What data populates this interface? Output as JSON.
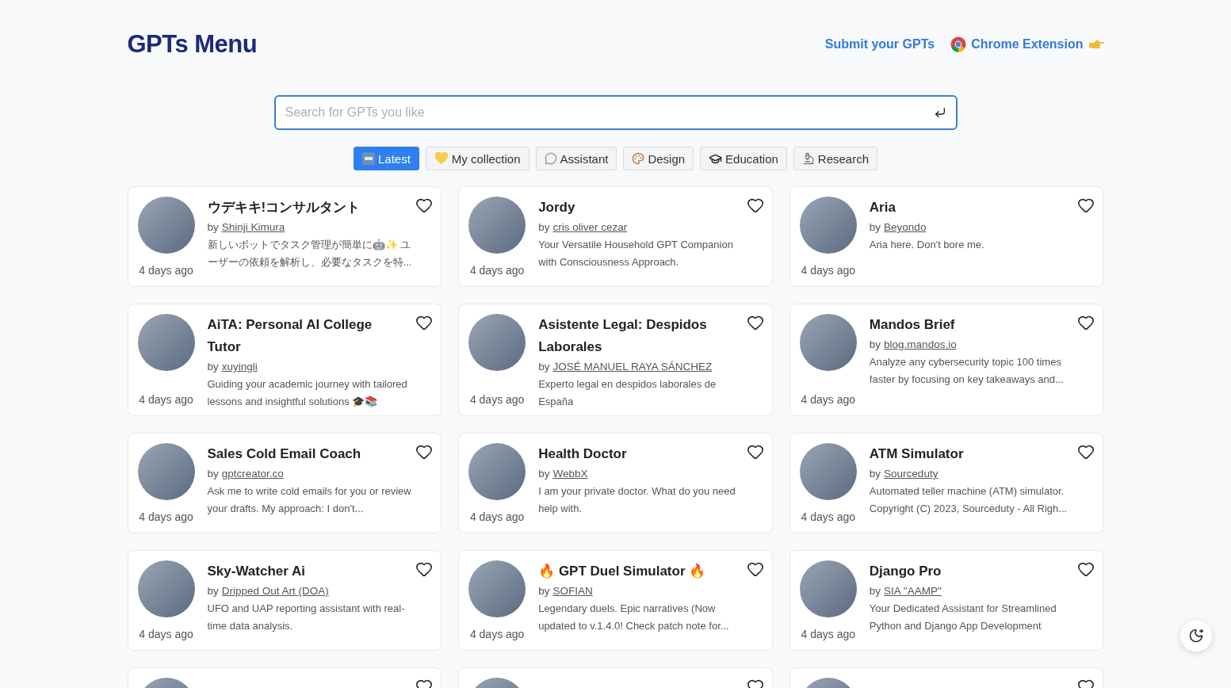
{
  "header": {
    "logo": "GPTs Menu",
    "links": [
      {
        "kind": "submit",
        "label": "Submit your GPTs"
      },
      {
        "kind": "extension",
        "label": "Chrome Extension"
      }
    ]
  },
  "search": {
    "placeholder": "Search for GPTs you like"
  },
  "tabs": [
    {
      "label": "Latest",
      "selected": true
    },
    {
      "label": "My collection",
      "selected": false
    },
    {
      "label": "Assistant",
      "selected": false
    },
    {
      "label": "Design",
      "selected": false
    },
    {
      "label": "Education",
      "selected": false
    },
    {
      "label": "Research",
      "selected": false
    }
  ],
  "cards": [
    {
      "title": "ウデキキ!コンサルタント",
      "by": "by",
      "author": "Shinji Kimura",
      "description": "新しいボットでタスク管理が簡単に🤖✨ ユーザーの依頼を解析し、必要なタスクを特...",
      "time": "4 days ago",
      "favorited": false
    },
    {
      "title": "Jordy",
      "by": "by",
      "author": "cris oliver cezar",
      "description": "Your Versatile Household GPT Companion with Consciousness Approach.",
      "time": "4 days ago",
      "favorited": false
    },
    {
      "title": "Aria",
      "by": "by",
      "author": "Beyondo ",
      "description": "Aria here. Don't bore me.",
      "time": "4 days ago",
      "favorited": false
    },
    {
      "title": "AiTA: Personal AI College Tutor",
      "by": "by",
      "author": "xuyingli",
      "description": "Guiding your academic journey with tailored lessons and insightful solutions 🎓📚",
      "time": "4 days ago",
      "favorited": false
    },
    {
      "title": "Asistente Legal: Despidos Laborales",
      "by": "by",
      "author": "JOSÉ MANUEL RAYA SÁNCHEZ",
      "description": "Experto legal en despidos laborales de España",
      "time": "4 days ago",
      "favorited": false
    },
    {
      "title": "Mandos Brief",
      "by": "by",
      "author": "blog.mandos.io",
      "description": "Analyze any cybersecurity topic 100 times faster by focusing on key takeaways and...",
      "time": "4 days ago",
      "favorited": false
    },
    {
      "title": "Sales Cold Email Coach",
      "by": "by",
      "author": "gptcreator.co",
      "description": "Ask me to write cold emails for you or review your drafts. My approach: I don't...",
      "time": "4 days ago",
      "favorited": false
    },
    {
      "title": "Health Doctor",
      "by": "by",
      "author": "WebbX",
      "description": "I am your private doctor. What do you need help with.",
      "time": "4 days ago",
      "favorited": false
    },
    {
      "title": "ATM Simulator",
      "by": "by",
      "author": "Sourceduty",
      "description": "Automated teller machine (ATM) simulator. Copyright (C) 2023, Sourceduty - All Righ...",
      "time": "4 days ago",
      "favorited": false
    },
    {
      "title": "Sky-Watcher Ai",
      "by": "by",
      "author": "Dripped Out Art (DOA)",
      "description": "UFO and UAP reporting assistant with real-time data analysis.",
      "time": "4 days ago",
      "favorited": false
    },
    {
      "title": "🔥 GPT Duel Simulator 🔥",
      "by": "by",
      "author": "SOFIAN",
      "description": "Legendary duels. Epic narratives (Now updated to v.1.4.0! Check patch note for...",
      "time": "4 days ago",
      "favorited": false
    },
    {
      "title": "Django Pro",
      "by": "by",
      "author": "SIA \"AAMP\"",
      "description": "Your Dedicated Assistant for Streamlined Python and Django App Development",
      "time": "4 days ago",
      "favorited": false
    }
  ],
  "cut_off_cards": [
    {
      "kind": "cut_off"
    },
    {
      "kind": "cut_off"
    },
    {
      "kind": "cut_off"
    }
  ]
}
